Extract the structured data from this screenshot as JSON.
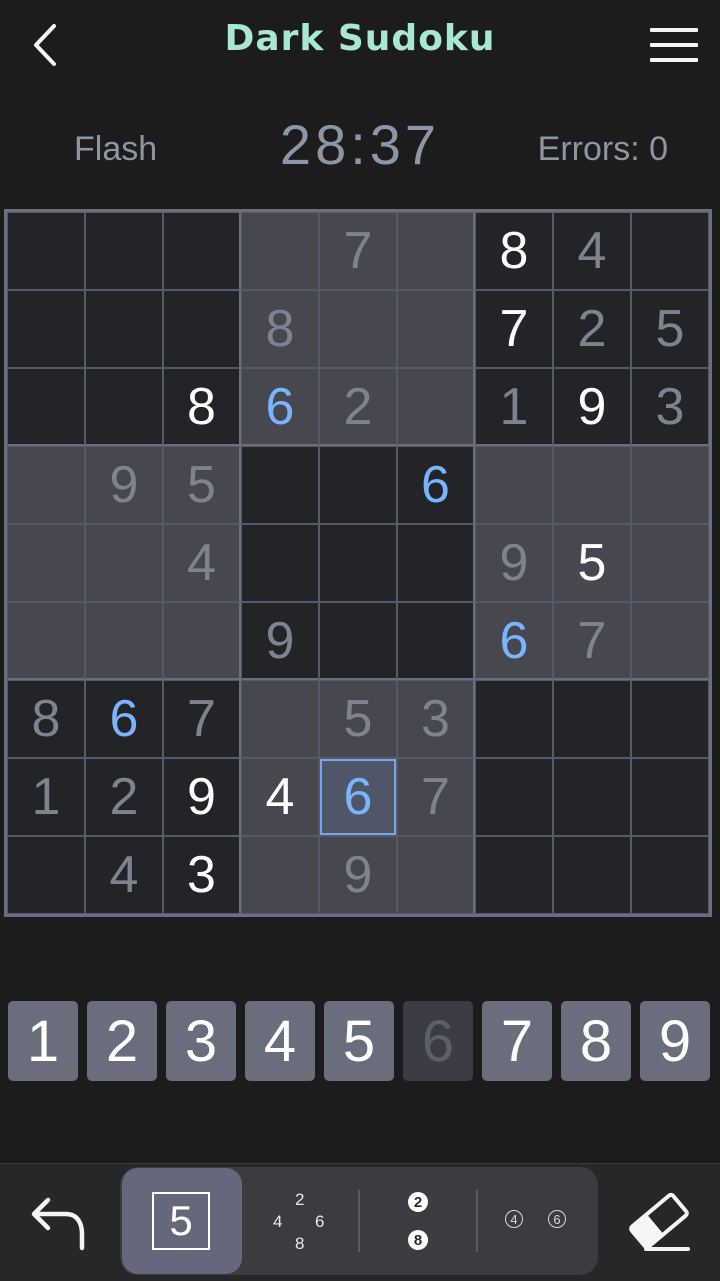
{
  "header": {
    "title": "Dark Sudoku",
    "back_icon": "chevron-left-icon",
    "menu_icon": "hamburger-menu-icon"
  },
  "status": {
    "mode": "Flash",
    "timer": "28:37",
    "errors": "Errors: 0"
  },
  "board": {
    "cells": [
      [
        "",
        "",
        "",
        "",
        "7",
        "",
        "8",
        "4",
        ""
      ],
      [
        "",
        "",
        "",
        "8",
        "",
        "",
        "7",
        "2",
        "5"
      ],
      [
        "",
        "",
        "8",
        "6",
        "2",
        "",
        "1",
        "9",
        "3"
      ],
      [
        "",
        "9",
        "5",
        "",
        "",
        "6",
        "",
        "",
        ""
      ],
      [
        "",
        "",
        "4",
        "",
        "",
        "",
        "9",
        "5",
        ""
      ],
      [
        "",
        "",
        "",
        "9",
        "",
        "",
        "6",
        "7",
        ""
      ],
      [
        "8",
        "6",
        "7",
        "",
        "5",
        "3",
        "",
        "",
        ""
      ],
      [
        "1",
        "2",
        "9",
        "4",
        "6",
        "7",
        "",
        "",
        ""
      ],
      [
        "",
        "4",
        "3",
        "",
        "9",
        "",
        "",
        "",
        ""
      ]
    ],
    "styles": [
      [
        "",
        "",
        "",
        "",
        "e",
        "",
        "g",
        "e",
        ""
      ],
      [
        "",
        "",
        "",
        "e",
        "",
        "",
        "g",
        "e",
        "e"
      ],
      [
        "",
        "",
        "g",
        "h",
        "e",
        "",
        "e",
        "g",
        "e"
      ],
      [
        "",
        "e",
        "e",
        "",
        "",
        "h",
        "",
        "",
        ""
      ],
      [
        "",
        "",
        "e",
        "",
        "",
        "",
        "e",
        "g",
        ""
      ],
      [
        "",
        "",
        "",
        "e",
        "",
        "",
        "h",
        "e",
        ""
      ],
      [
        "e",
        "h",
        "e",
        "",
        "e",
        "e",
        "",
        "",
        ""
      ],
      [
        "e",
        "e",
        "g",
        "g",
        "h",
        "e",
        "",
        "",
        ""
      ],
      [
        "",
        "e",
        "g",
        "",
        "e",
        "",
        "",
        "",
        ""
      ]
    ],
    "shading": [
      [
        "d",
        "d",
        "d",
        "l",
        "l",
        "l",
        "d",
        "d",
        "d"
      ],
      [
        "d",
        "d",
        "d",
        "l",
        "l",
        "l",
        "d",
        "d",
        "d"
      ],
      [
        "d",
        "d",
        "d",
        "l",
        "l",
        "l",
        "d",
        "d",
        "d"
      ],
      [
        "l",
        "l",
        "l",
        "d",
        "d",
        "d",
        "l",
        "l",
        "l"
      ],
      [
        "l",
        "l",
        "l",
        "d",
        "d",
        "d",
        "l",
        "l",
        "l"
      ],
      [
        "l",
        "l",
        "l",
        "d",
        "d",
        "d",
        "l",
        "l",
        "l"
      ],
      [
        "d",
        "d",
        "d",
        "l",
        "l",
        "l",
        "d",
        "d",
        "d"
      ],
      [
        "d",
        "d",
        "d",
        "l",
        "l",
        "l",
        "d",
        "d",
        "d"
      ],
      [
        "d",
        "d",
        "d",
        "l",
        "l",
        "l",
        "d",
        "d",
        "d"
      ]
    ],
    "selected": [
      7,
      4
    ],
    "colors": {
      "given": "#ffffff",
      "entered": "#7f8390",
      "highlight": "#7ab4ff",
      "selection_border": "#7aa6f0"
    }
  },
  "numpad": {
    "keys": [
      "1",
      "2",
      "3",
      "4",
      "5",
      "6",
      "7",
      "8",
      "9"
    ],
    "used": [
      "6"
    ]
  },
  "toolbar": {
    "undo_icon": "undo-arrow-icon",
    "normal_mode_value": "5",
    "pencil_values": {
      "top": "2",
      "left": "4",
      "right": "6",
      "bottom": "8"
    },
    "circle_values": [
      "2",
      "8"
    ],
    "ring_values": [
      "4",
      "6"
    ],
    "eraser_icon": "eraser-icon"
  }
}
